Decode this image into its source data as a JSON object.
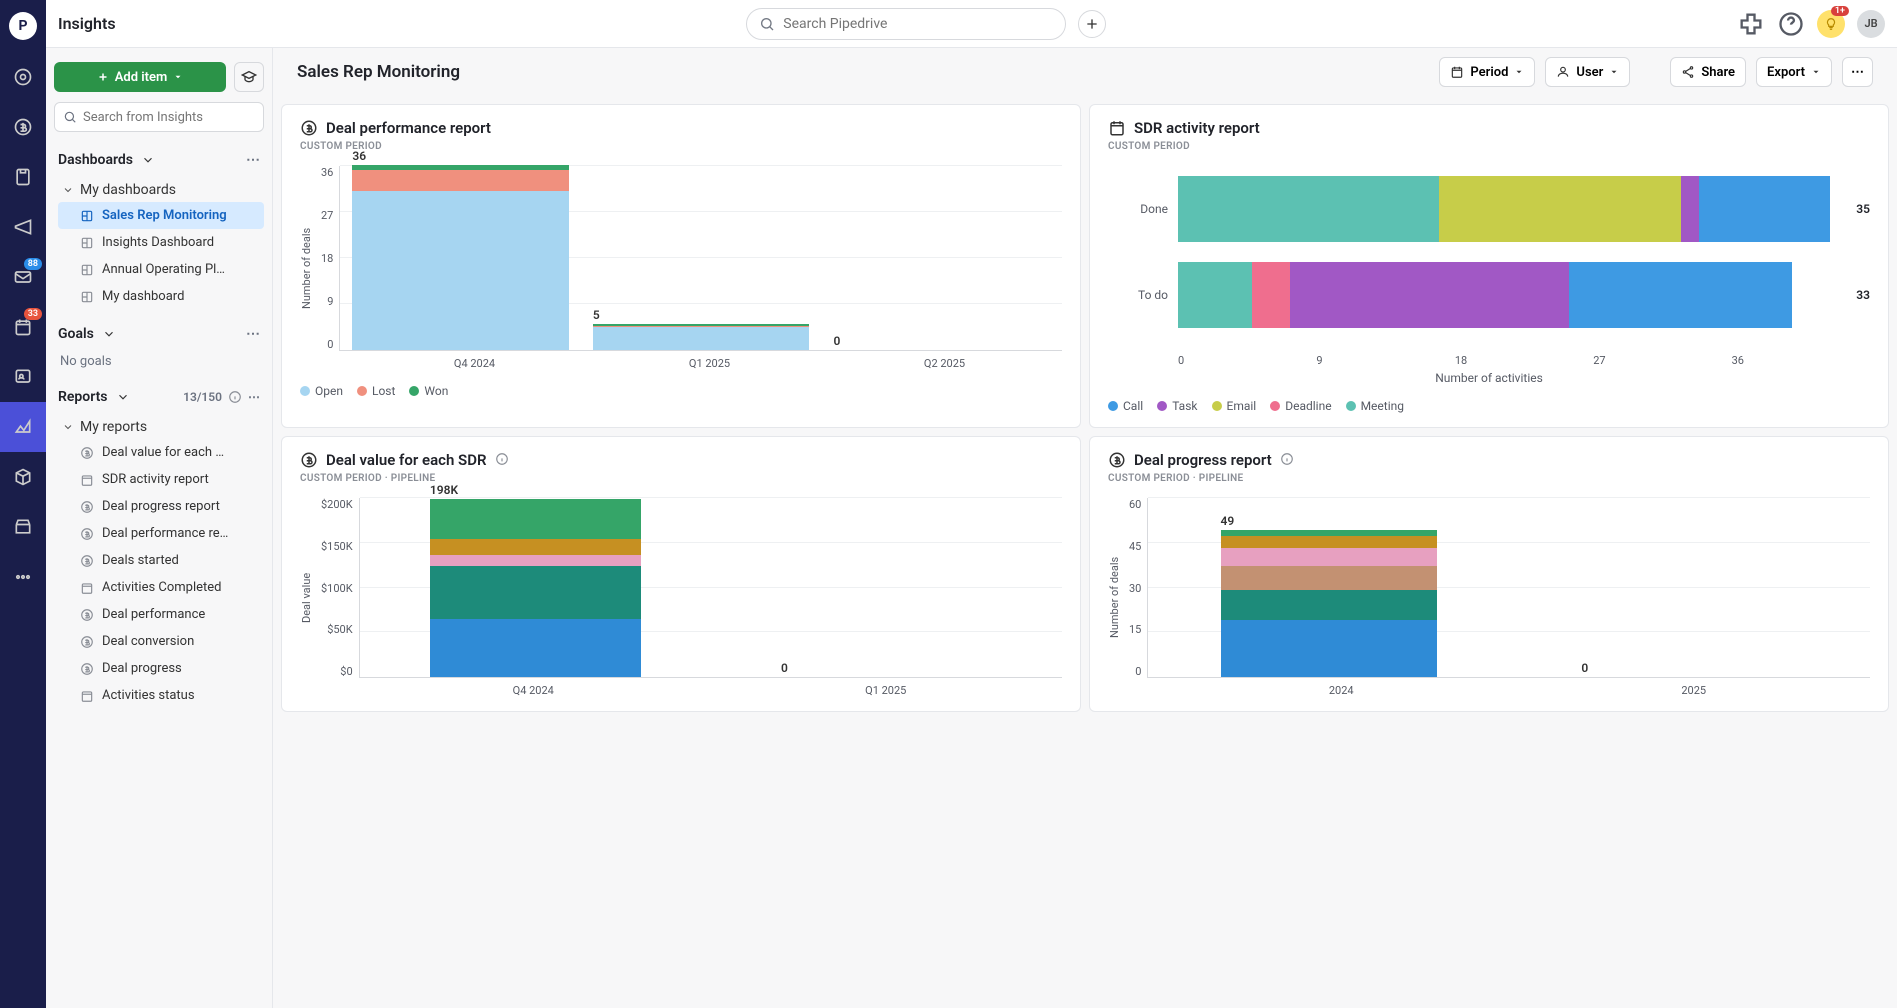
{
  "app_title": "Insights",
  "search_placeholder": "Search Pipedrive",
  "avatar_initials": "JB",
  "sales_bulb_badge": "1+",
  "rail_badges": {
    "envelope": "88",
    "calendar": "33"
  },
  "add_item_label": "Add item",
  "sidebar_search_placeholder": "Search from Insights",
  "dashboards": {
    "header": "Dashboards",
    "groups": [
      {
        "label": "My dashboards",
        "items": [
          {
            "label": "Sales Rep Monitoring",
            "active": true
          },
          {
            "label": "Insights Dashboard"
          },
          {
            "label": "Annual Operating Pl…"
          },
          {
            "label": "My dashboard"
          }
        ]
      }
    ]
  },
  "goals": {
    "header": "Goals",
    "empty_label": "No goals"
  },
  "reports": {
    "header": "Reports",
    "count": "13/150",
    "groups": [
      {
        "label": "My reports",
        "items": [
          {
            "label": "Deal value for each …"
          },
          {
            "label": "SDR activity report"
          },
          {
            "label": "Deal progress report"
          },
          {
            "label": "Deal performance re…"
          },
          {
            "label": "Deals started"
          },
          {
            "label": "Activities Completed"
          },
          {
            "label": "Deal performance"
          },
          {
            "label": "Deal conversion"
          },
          {
            "label": "Deal progress"
          },
          {
            "label": "Activities status"
          }
        ]
      }
    ]
  },
  "content_title": "Sales Rep Monitoring",
  "toolbar": {
    "period": "Period",
    "user": "User",
    "share": "Share",
    "export": "Export"
  },
  "subtitle_custom": "CUSTOM PERIOD",
  "subtitle_custom_pipeline": "CUSTOM PERIOD  ·  PIPELINE",
  "chart_data": [
    {
      "id": "deal_performance",
      "title": "Deal performance report",
      "type": "bar",
      "stacked": true,
      "ylabel": "Number of deals",
      "categories": [
        "Q4 2024",
        "Q1 2025",
        "Q2 2025"
      ],
      "series": [
        {
          "name": "Open",
          "color": "#a6d5f1",
          "values": [
            31,
            4.5,
            0
          ]
        },
        {
          "name": "Lost",
          "color": "#f0907e",
          "values": [
            4,
            0.25,
            0
          ]
        },
        {
          "name": "Won",
          "color": "#35a568",
          "values": [
            1,
            0.25,
            0
          ]
        }
      ],
      "totals": [
        36,
        5,
        0
      ],
      "y_ticks": [
        0,
        9,
        18,
        27,
        36
      ]
    },
    {
      "id": "sdr_activity",
      "title": "SDR activity report",
      "type": "hbar",
      "stacked": true,
      "xlabel": "Number of activities",
      "categories": [
        "Done",
        "To do"
      ],
      "series": [
        {
          "name": "Call",
          "color": "#3e9ae3"
        },
        {
          "name": "Task",
          "color": "#a158c5"
        },
        {
          "name": "Email",
          "color": "#c7cd49"
        },
        {
          "name": "Deadline",
          "color": "#ef6e8e"
        },
        {
          "name": "Meeting",
          "color": "#5cc1b2"
        }
      ],
      "rows": [
        {
          "label": "Done",
          "total": 35,
          "segments": [
            {
              "name": "Meeting",
              "color": "#5cc1b2",
              "value": 14
            },
            {
              "name": "Email",
              "color": "#c7cd49",
              "value": 13
            },
            {
              "name": "Task",
              "color": "#a158c5",
              "value": 1
            },
            {
              "name": "Call",
              "color": "#3e9ae3",
              "value": 7
            }
          ]
        },
        {
          "label": "To do",
          "total": 33,
          "segments": [
            {
              "name": "Meeting",
              "color": "#5cc1b2",
              "value": 4
            },
            {
              "name": "Deadline",
              "color": "#ef6e8e",
              "value": 2
            },
            {
              "name": "Task",
              "color": "#a158c5",
              "value": 15
            },
            {
              "name": "Call",
              "color": "#3e9ae3",
              "value": 12
            }
          ]
        }
      ],
      "x_ticks": [
        0,
        9,
        18,
        27,
        36
      ]
    },
    {
      "id": "deal_value_sdr",
      "title": "Deal value for each SDR",
      "type": "bar",
      "stacked": true,
      "ylabel": "Deal value",
      "categories": [
        "Q4 2024",
        "Q1 2025"
      ],
      "totals": [
        "198K",
        "0"
      ],
      "series": [
        {
          "color": "#2f8bd6",
          "values": [
            65,
            0
          ]
        },
        {
          "color": "#1d8b7a",
          "values": [
            58,
            0
          ]
        },
        {
          "color": "#e7a0c0",
          "values": [
            13,
            0
          ]
        },
        {
          "color": "#c69022",
          "values": [
            17,
            0
          ]
        },
        {
          "color": "#35a568",
          "values": [
            45,
            0
          ]
        }
      ],
      "y_ticks": [
        "$0",
        "$50K",
        "$100K",
        "$150K",
        "$200K"
      ]
    },
    {
      "id": "deal_progress",
      "title": "Deal progress report",
      "type": "bar",
      "stacked": true,
      "ylabel": "Number of deals",
      "categories": [
        "2024",
        "2025"
      ],
      "totals": [
        49,
        0
      ],
      "series": [
        {
          "color": "#2f8bd6",
          "values": [
            19,
            0
          ]
        },
        {
          "color": "#1d8b7a",
          "values": [
            10,
            0
          ]
        },
        {
          "color": "#c39172",
          "values": [
            8,
            0
          ]
        },
        {
          "color": "#e7a0c0",
          "values": [
            6,
            0
          ]
        },
        {
          "color": "#c69022",
          "values": [
            4,
            0
          ]
        },
        {
          "color": "#35a568",
          "values": [
            2,
            0
          ]
        }
      ],
      "y_ticks": [
        0,
        15,
        30,
        45,
        60
      ]
    }
  ]
}
